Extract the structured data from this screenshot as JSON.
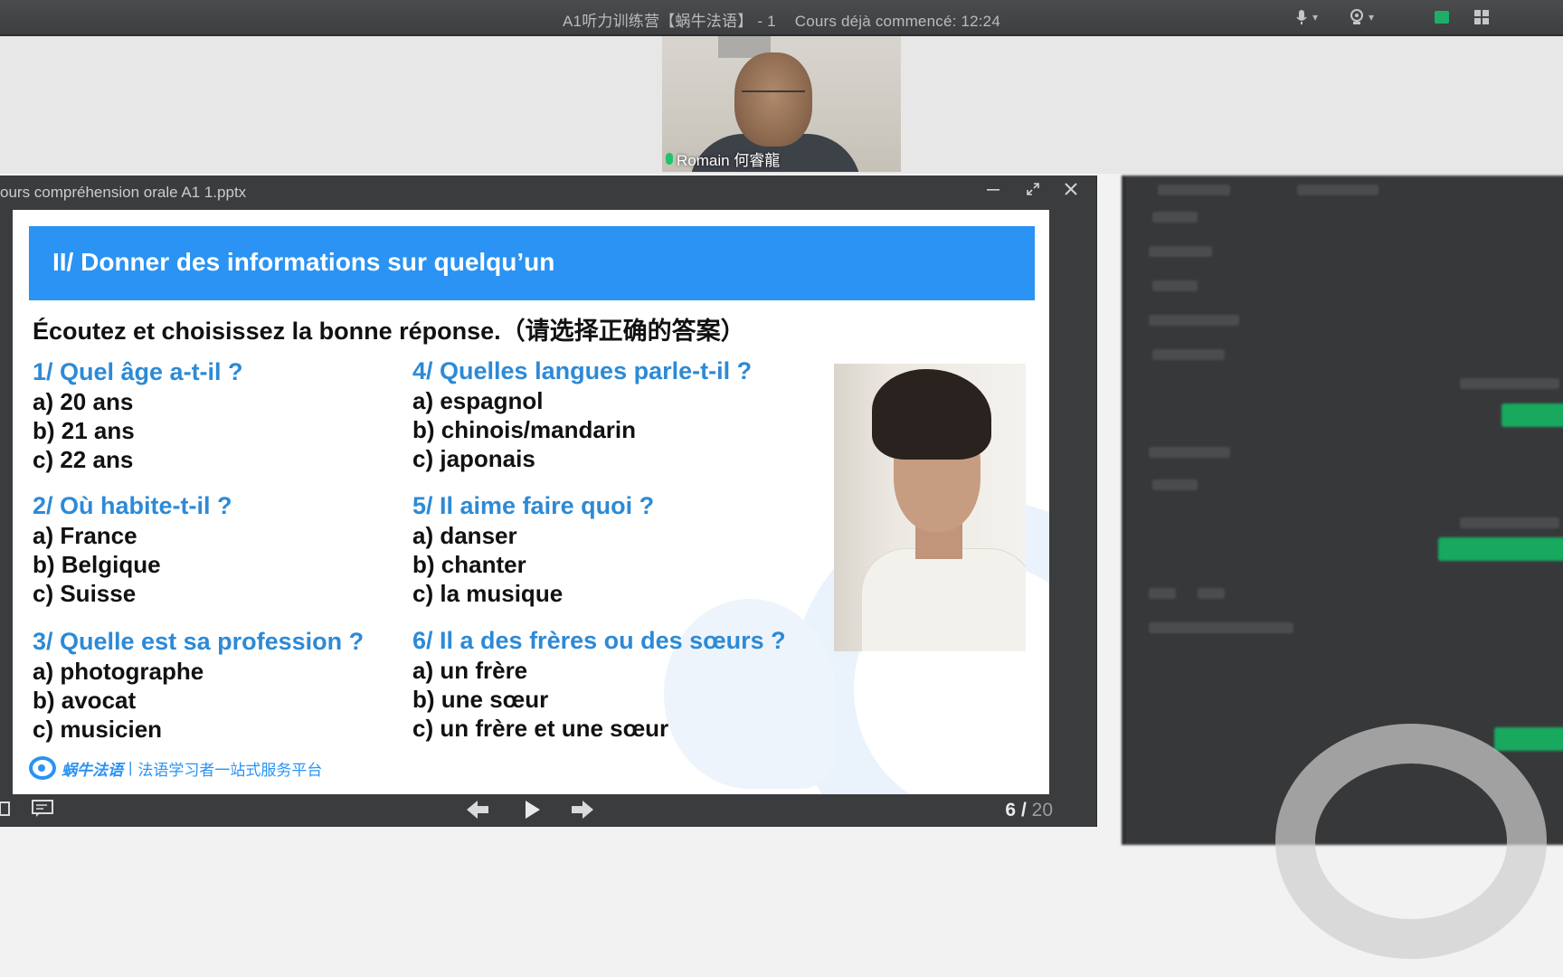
{
  "topbar": {
    "title": "A1听力训练营【蜗牛法语】 - 1",
    "status": "Cours déjà commencé: 12:24"
  },
  "video": {
    "participant_name": "Romain 何睿龍"
  },
  "presentation": {
    "filename": "ours compréhension orale A1 1.pptx",
    "page_current": "6",
    "page_separator": "/",
    "page_total": "20"
  },
  "slide": {
    "header": "II/ Donner des informations sur quelqu’un",
    "instruction": "Écoutez et choisissez la bonne réponse.（请选择正确的答案）",
    "questions": [
      {
        "title": "1/ Quel âge a-t-il ?",
        "options": [
          "a) 20 ans",
          "b) 21 ans",
          "c) 22 ans"
        ]
      },
      {
        "title": "2/ Où habite-t-il ?",
        "options": [
          "a) France",
          "b) Belgique",
          "c) Suisse"
        ]
      },
      {
        "title": "3/ Quelle est sa profession ?",
        "options": [
          "a) photographe",
          "b) avocat",
          "c) musicien"
        ]
      },
      {
        "title": "4/ Quelles langues parle-t-il ?",
        "options": [
          "a) espagnol",
          "b) chinois/mandarin",
          "c) japonais"
        ]
      },
      {
        "title": "5/ Il aime faire quoi ?",
        "options": [
          "a) danser",
          "b) chanter",
          "c) la musique"
        ]
      },
      {
        "title": "6/ Il a des frères ou des sœurs ?",
        "options": [
          "a) un frère",
          "b) une sœur",
          "c) un frère et une sœur"
        ]
      }
    ],
    "logo_brand": "蜗牛法语",
    "logo_divider": "|",
    "logo_tagline": "法语学习者一站式服务平台"
  },
  "icons": {
    "mic": "mic-icon",
    "camera": "camera-icon",
    "minimize": "minimize-icon",
    "maximize": "maximize-icon",
    "close": "close-icon",
    "prev": "prev-slide-icon",
    "play": "play-icon",
    "next": "next-slide-icon"
  },
  "colors": {
    "header_blue": "#2a93f3",
    "question_blue": "#2d8ad6",
    "accent_green": "#1fae6a"
  }
}
